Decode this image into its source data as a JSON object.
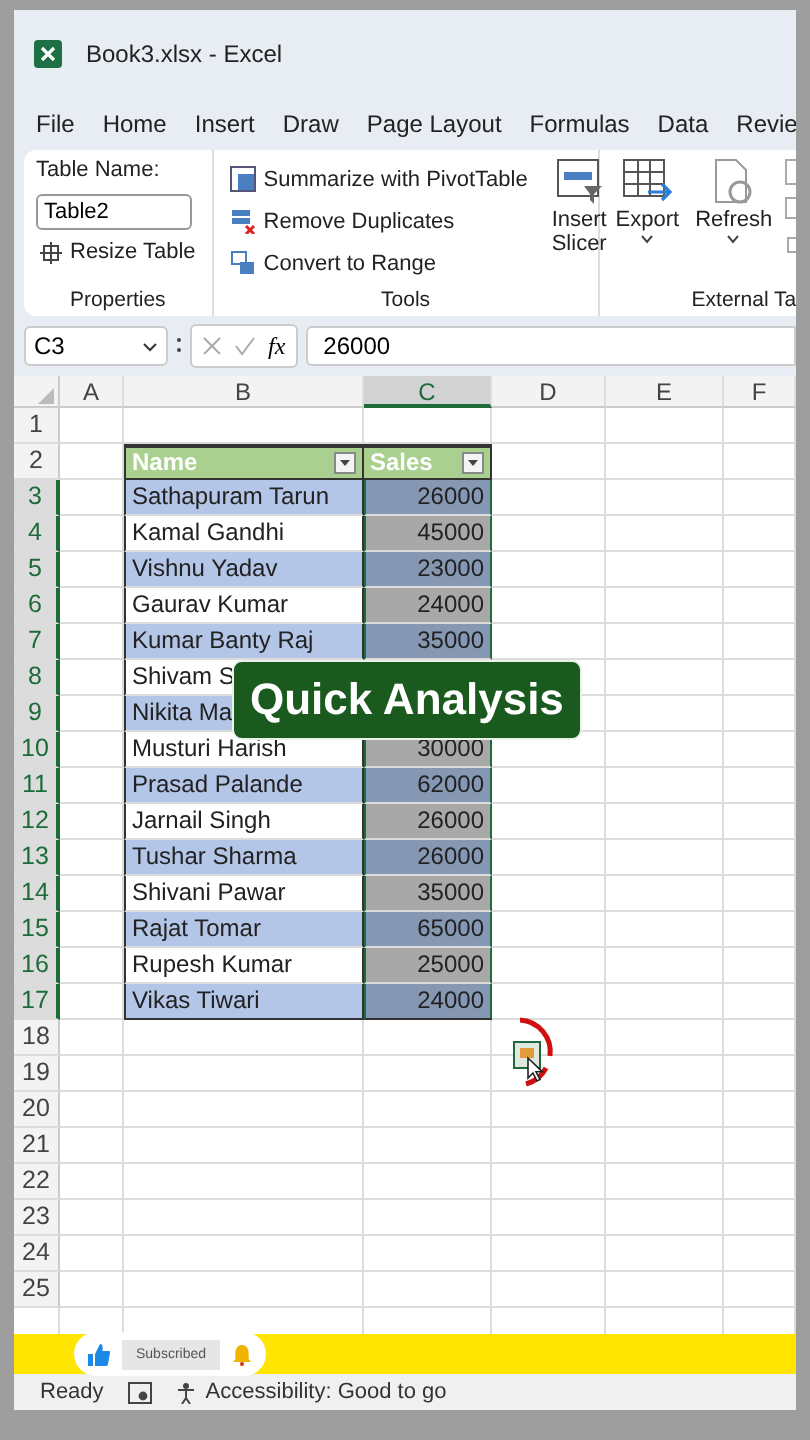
{
  "window": {
    "title": "Book3.xlsx  -  Excel"
  },
  "menu_tabs": [
    {
      "label": "File",
      "selected": false
    },
    {
      "label": "Home",
      "selected": false
    },
    {
      "label": "Insert",
      "selected": false
    },
    {
      "label": "Draw",
      "selected": false
    },
    {
      "label": "Page Layout",
      "selected": false
    },
    {
      "label": "Formulas",
      "selected": false
    },
    {
      "label": "Data",
      "selected": false
    },
    {
      "label": "Revie",
      "selected": false
    }
  ],
  "ribbon": {
    "table_name_label": "Table Name:",
    "table_name": "Table2",
    "resize_table": "Resize Table",
    "tools": [
      "Summarize with PivotTable",
      "Remove Duplicates",
      "Convert to Range"
    ],
    "insert_slicer": "Insert Slicer",
    "export": "Export",
    "refresh": "Refresh",
    "groups": [
      "Properties",
      "Tools",
      "External Ta"
    ]
  },
  "formula_bar": {
    "name_box": "C3",
    "function_label": "fx",
    "value": "26000"
  },
  "columns": [
    {
      "label": "A",
      "selected": false
    },
    {
      "label": "B",
      "selected": false
    },
    {
      "label": "C",
      "selected": true
    },
    {
      "label": "D",
      "selected": false
    },
    {
      "label": "E",
      "selected": false
    },
    {
      "label": "F",
      "selected": false
    }
  ],
  "row_headers": [
    {
      "label": "1",
      "selected": false
    },
    {
      "label": "2",
      "selected": false
    },
    {
      "label": "3",
      "selected": true
    },
    {
      "label": "4",
      "selected": true
    },
    {
      "label": "5",
      "selected": true
    },
    {
      "label": "6",
      "selected": true
    },
    {
      "label": "7",
      "selected": true
    },
    {
      "label": "8",
      "selected": true
    },
    {
      "label": "9",
      "selected": true
    },
    {
      "label": "10",
      "selected": true
    },
    {
      "label": "11",
      "selected": true
    },
    {
      "label": "12",
      "selected": true
    },
    {
      "label": "13",
      "selected": true
    },
    {
      "label": "14",
      "selected": true
    },
    {
      "label": "15",
      "selected": true
    },
    {
      "label": "16",
      "selected": true
    },
    {
      "label": "17",
      "selected": true
    },
    {
      "label": "18",
      "selected": false
    },
    {
      "label": "19",
      "selected": false
    },
    {
      "label": "20",
      "selected": false
    },
    {
      "label": "21",
      "selected": false
    },
    {
      "label": "22",
      "selected": false
    },
    {
      "label": "23",
      "selected": false
    },
    {
      "label": "24",
      "selected": false
    },
    {
      "label": "25",
      "selected": false
    }
  ],
  "table": {
    "headers": [
      "Name",
      "Sales"
    ],
    "rows": [
      {
        "name": "Sathapuram Tarun",
        "sales": "26000"
      },
      {
        "name": "Kamal Gandhi",
        "sales": "45000"
      },
      {
        "name": "Vishnu Yadav",
        "sales": "23000"
      },
      {
        "name": "Gaurav Kumar",
        "sales": "24000"
      },
      {
        "name": "Kumar Banty Raj",
        "sales": "35000"
      },
      {
        "name": "Shivam S"
      },
      {
        "name": "Nikita Ma"
      },
      {
        "name": "Musturi Harish",
        "sales": "30000"
      },
      {
        "name": "Prasad Palande",
        "sales": "62000"
      },
      {
        "name": "Jarnail Singh",
        "sales": "26000"
      },
      {
        "name": "Tushar Sharma",
        "sales": "26000"
      },
      {
        "name": "Shivani Pawar",
        "sales": "35000"
      },
      {
        "name": "Rajat Tomar",
        "sales": "65000"
      },
      {
        "name": "Rupesh Kumar",
        "sales": "25000"
      },
      {
        "name": "Vikas Tiwari",
        "sales": "24000"
      }
    ]
  },
  "caption": "Quick Analysis",
  "subscribe_bar": {
    "label": "Subscribed"
  },
  "status_bar": {
    "mode": "Ready",
    "accessibility": "Accessibility: Good to go"
  }
}
